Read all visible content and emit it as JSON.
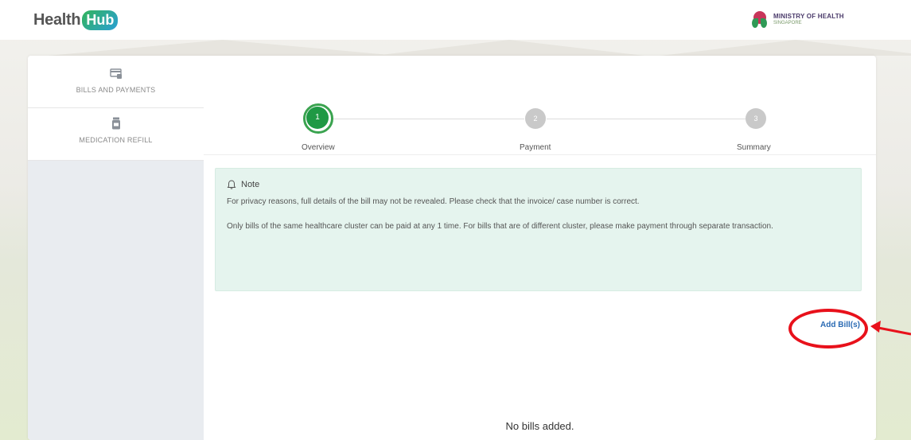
{
  "header": {
    "logo_text": "Health",
    "logo_badge": "Hub",
    "ministry_line1": "MINISTRY OF HEALTH",
    "ministry_line2": "SINGAPORE"
  },
  "sidebar": {
    "items": [
      {
        "label": "BILLS AND PAYMENTS",
        "icon": "bill-icon"
      },
      {
        "label": "MEDICATION REFILL",
        "icon": "medicine-bottle-icon"
      }
    ]
  },
  "stepper": {
    "steps": [
      {
        "number": "1",
        "label": "Overview",
        "state": "active"
      },
      {
        "number": "2",
        "label": "Payment",
        "state": "pending"
      },
      {
        "number": "3",
        "label": "Summary",
        "state": "pending"
      }
    ],
    "active_color": "#1f9944"
  },
  "note": {
    "title": "Note",
    "paragraph1": "For privacy reasons, full details of the bill may not be revealed. Please check that the invoice/ case number is correct.",
    "paragraph2": "Only bills of the same healthcare cluster can be paid at any 1 time. For bills that are of different cluster, please make payment through separate transaction."
  },
  "actions": {
    "add_bill": "Add Bill(s)"
  },
  "empty_state": "No bills added.",
  "colors": {
    "note_bg": "#e5f4ee",
    "link": "#2a6ab3",
    "annotation": "#e8111b"
  }
}
